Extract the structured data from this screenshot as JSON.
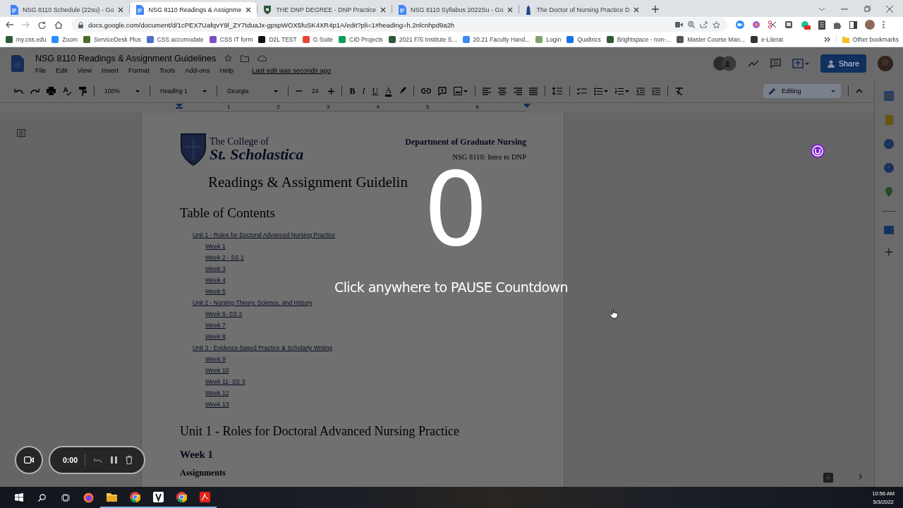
{
  "browser": {
    "tabs": [
      {
        "title": "NSG 8110 Schedule (22su) - Go",
        "kind": "docs",
        "selected": false
      },
      {
        "title": "NSG 8110 Readings & Assignme",
        "kind": "docs",
        "selected": true
      },
      {
        "title": "THE DNP DEGREE - DNP Practice",
        "kind": "shield",
        "selected": false
      },
      {
        "title": "NSG 8110 Syllabus 2022Su - Go",
        "kind": "docs",
        "selected": false
      },
      {
        "title": "The Doctor of Nursing Practice D",
        "kind": "tower",
        "selected": false
      }
    ],
    "url": "docs.google.com/document/d/1cPEX7UafqvY9l_ZY7tduaJx-gpspWOX5fuSK4XR4p1A/edit?pli=1#heading=h.2nlcnhpd9a2h",
    "bookmarks": [
      {
        "label": "my.css.edu",
        "color": "#2e5a3a"
      },
      {
        "label": "Zoom",
        "color": "#2d8cff"
      },
      {
        "label": "ServiceDesk Plus",
        "color": "#4a6a2a"
      },
      {
        "label": "CSS accomodate",
        "color": "#4a6fc4"
      },
      {
        "label": "CSS IT form",
        "color": "#7b4fbf"
      },
      {
        "label": "D2L TEST",
        "color": "#111111"
      },
      {
        "label": "G Suite",
        "color": "#ea4335"
      },
      {
        "label": "CID Projects",
        "color": "#0f9d58"
      },
      {
        "label": "2021 F/S Institute S...",
        "color": "#2e5a3a"
      },
      {
        "label": "20.21 Faculty Hand...",
        "color": "#4285f4"
      },
      {
        "label": "Login",
        "color": "#7fa36a"
      },
      {
        "label": "Qualtrics",
        "color": "#1a73e8"
      },
      {
        "label": "Brightspace - non-...",
        "color": "#2e5a3a"
      },
      {
        "label": "Master Course Man...",
        "color": "#555555"
      },
      {
        "label": "e-Literat",
        "color": "#333333"
      }
    ],
    "other_bookmarks": "Other bookmarks"
  },
  "docs": {
    "title": "NSG 8110 Readings & Assignment Guidelines",
    "menu": [
      "File",
      "Edit",
      "View",
      "Insert",
      "Format",
      "Tools",
      "Add-ons",
      "Help"
    ],
    "last_edit": "Last edit was seconds ago",
    "share": "Share",
    "toolbar": {
      "zoom": "100%",
      "style": "Heading 1",
      "font": "Georgia",
      "size": "24",
      "format": [
        "B",
        "I",
        "U",
        "A"
      ]
    },
    "mode": "Editing",
    "ruler": [
      "1",
      "2",
      "3",
      "4",
      "5",
      "6"
    ]
  },
  "page": {
    "logo_top": "The College of",
    "logo_bottom": "St. Scholastica",
    "department": "Department of Graduate Nursing",
    "course": "NSG 8110: Intro to DNP",
    "title": "Readings & Assignment Guidelin",
    "toc_heading": "Table of Contents",
    "toc": [
      {
        "text": "Unit 1 - Roles for Doctoral Advanced Nursing Practice",
        "children": [
          {
            "text": "Week 1"
          },
          {
            "text": "Week 2 - SS 1"
          },
          {
            "text": "Week 3"
          },
          {
            "text": "Week 4"
          },
          {
            "text": "Week 5"
          }
        ]
      },
      {
        "text": "Unit 2 - Nursing Theory, Science, and History",
        "children": [
          {
            "text": "Week 6- SS 2"
          },
          {
            "text": "Week 7"
          },
          {
            "text": "Week 8"
          }
        ]
      },
      {
        "text": "Unit 3 - Evidence-based Practice & Scholarly Writing",
        "children": [
          {
            "text": "Week 9"
          },
          {
            "text": "Week 10"
          },
          {
            "text": "Week 11- SS 3"
          },
          {
            "text": "Week 12"
          },
          {
            "text": "Week 13"
          }
        ]
      }
    ],
    "unit_heading": "Unit 1 - Roles for Doctoral Advanced Nursing Practice",
    "week_heading": "Week 1",
    "sub_heading": "Assignments"
  },
  "countdown": {
    "number": "0",
    "hint": "Click anywhere to PAUSE Countdown"
  },
  "recorder": {
    "time": "0:00"
  },
  "taskbar": {
    "time": "10:56 AM",
    "date": "5/3/2022"
  }
}
